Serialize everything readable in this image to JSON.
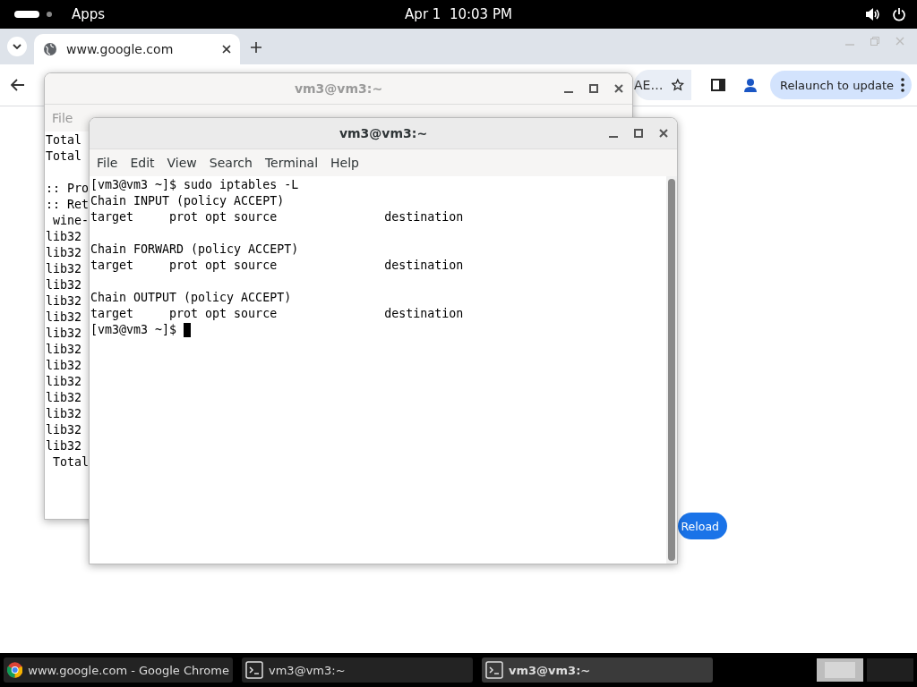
{
  "top_bar": {
    "apps_label": "Apps",
    "clock": "Apr 1  10:03 PM"
  },
  "browser": {
    "tabs": [
      {
        "title": "www.google.com",
        "selected": true
      }
    ],
    "address_fragment": "AE…",
    "relaunch_label": "Relaunch to update",
    "reload_label": "Reload"
  },
  "windows": [
    {
      "title": "vm3@vm3:~",
      "focused": false,
      "menu": [
        "File"
      ],
      "blocks": [
        [
          "Total",
          "Total"
        ],
        [
          ":: Pro",
          ":: Ret",
          " wine-",
          "lib32",
          "lib32",
          "lib32",
          "lib32",
          "lib32",
          "lib32",
          "lib32",
          "lib32",
          "lib32",
          "lib32",
          "lib32",
          "lib32",
          "lib32",
          "lib32",
          " Total"
        ]
      ]
    },
    {
      "title": "vm3@vm3:~",
      "focused": true,
      "menu": [
        "File",
        "Edit",
        "View",
        "Search",
        "Terminal",
        "Help"
      ],
      "blocks": [
        [
          "[vm3@vm3 ~]$ sudo iptables -L",
          "Chain INPUT (policy ACCEPT)",
          "target     prot opt source               destination"
        ],
        [
          "Chain FORWARD (policy ACCEPT)",
          "target     prot opt source               destination"
        ],
        [
          "Chain OUTPUT (policy ACCEPT)",
          "target     prot opt source               destination",
          "[vm3@vm3 ~]$ "
        ]
      ],
      "cursor": true
    }
  ],
  "taskbar": {
    "items": [
      {
        "label": "www.google.com - Google Chrome",
        "kind": "chrome",
        "selected": false
      },
      {
        "label": "vm3@vm3:~",
        "kind": "terminal",
        "selected": false
      },
      {
        "label": "vm3@vm3:~",
        "kind": "terminal",
        "selected": true
      }
    ],
    "workspaces": [
      {
        "selected": true
      },
      {
        "selected": false
      }
    ]
  }
}
